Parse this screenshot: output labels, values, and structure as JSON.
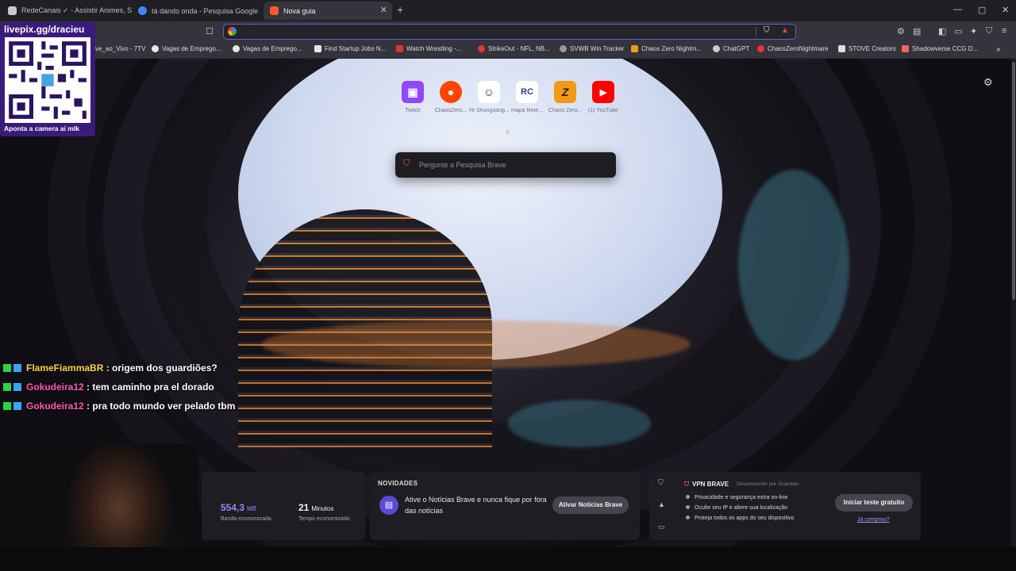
{
  "tabs": [
    {
      "title": "RedeCanais ✓ - Assistir Animes, Séri...",
      "favicon_color": "#c9c9d0",
      "active": false
    },
    {
      "title": "tá dando onda - Pesquisa Google",
      "favicon_color": "#4285f4",
      "active": false
    },
    {
      "title": "Nova guia",
      "favicon_color": "#ff5a2b",
      "active": true
    }
  ],
  "tab_close": "✕",
  "new_tab": "+",
  "window_controls": {
    "minimize": "—",
    "maximize": "▢",
    "close": "✕"
  },
  "address_bar": {
    "value": "",
    "placeholder": ""
  },
  "bookmarks": [
    {
      "label": "ve_ao_Vivo - 7TV",
      "color": "#444"
    },
    {
      "label": "Vagas de Emprego...",
      "color": "#e6e6e6"
    },
    {
      "label": "Vagas de Emprego...",
      "color": "#e6e6e6"
    },
    {
      "label": "Find Startup Jobs N...",
      "color": "#e6e6e6"
    },
    {
      "label": "Watch Wrestling -...",
      "color": "#d33"
    },
    {
      "label": "StrikeOut - NFL, NB...",
      "color": "#e33"
    },
    {
      "label": "SVWB Win Tracker",
      "color": "#999"
    },
    {
      "label": "Chaos Zero Nightm...",
      "color": "#f29a18"
    },
    {
      "label": "ChatGPT",
      "color": "#ccc"
    },
    {
      "label": "ChaosZeroNightmare",
      "color": "#e33"
    },
    {
      "label": "STOVE Creators",
      "color": "#ddd"
    },
    {
      "label": "Shadowverse CCG D...",
      "color": "#e66"
    }
  ],
  "top_sites": [
    {
      "label": "Twitch",
      "glyph": "▣",
      "bg": "#9146ff",
      "fg": "#fff",
      "icon": "twitch-icon"
    },
    {
      "label": "ChaosZero...",
      "glyph": "●",
      "bg": "#ff4500",
      "fg": "#fff",
      "icon": "reddit-icon"
    },
    {
      "label": "Ye Shunguang...",
      "glyph": "☺",
      "bg": "#ffffff",
      "fg": "#333",
      "icon": "character-icon"
    },
    {
      "label": "mapa filme...",
      "glyph": "RC",
      "bg": "#ffffff",
      "fg": "#1f3f9a",
      "icon": "rc-icon"
    },
    {
      "label": "Chaos Zero...",
      "glyph": "Z",
      "bg": "#f29a18",
      "fg": "#1a1a1a",
      "icon": "chaos-zero-icon"
    },
    {
      "label": "(1) YouTube",
      "glyph": "▶",
      "bg": "#ff0000",
      "fg": "#fff",
      "icon": "youtube-icon"
    }
  ],
  "search": {
    "placeholder": "Pergunte a Pesquisa Brave"
  },
  "stats": {
    "bandwidth_value": "554,3",
    "bandwidth_unit": "MB",
    "bandwidth_label": "Banda economizada",
    "time_value": "21",
    "time_unit": "Minutos",
    "time_label": "Tempo economizado"
  },
  "news": {
    "title": "NOVIDADES",
    "text": "Ative o Notícias Brave e nunca fique por fora das notícias",
    "button": "Ativar Notícias Brave"
  },
  "vpn": {
    "title": "VPN BRAVE",
    "developer": "Desenvolvido por Guardian",
    "features": [
      "Privacidade e segurança extra on-line",
      "Oculte seu IP e altere sua localização",
      "Proteja todos os apps do seu dispositivo"
    ],
    "button": "Iniciar teste gratuito",
    "link": "Já comprou?"
  },
  "overlay": {
    "url": "livepix.gg/dracieu",
    "caption": "Aponta a camera ai mlk"
  },
  "chat": [
    {
      "user": "FlameFiammaBR",
      "message": " : origem dos guardiões?",
      "user_color": "#ffd24a"
    },
    {
      "user": "Gokudeira12",
      "message": " : tem caminho pra el dorado",
      "user_color": "#ff5cae"
    },
    {
      "user": "Gokudeira12",
      "message": " : pra todo mundo ver pelado tbm",
      "user_color": "#ff5cae"
    }
  ],
  "colors": {
    "accent": "#6b5bd6",
    "brave_orange": "#ff5a2b",
    "vpn_pink": "#ff4f7b"
  }
}
